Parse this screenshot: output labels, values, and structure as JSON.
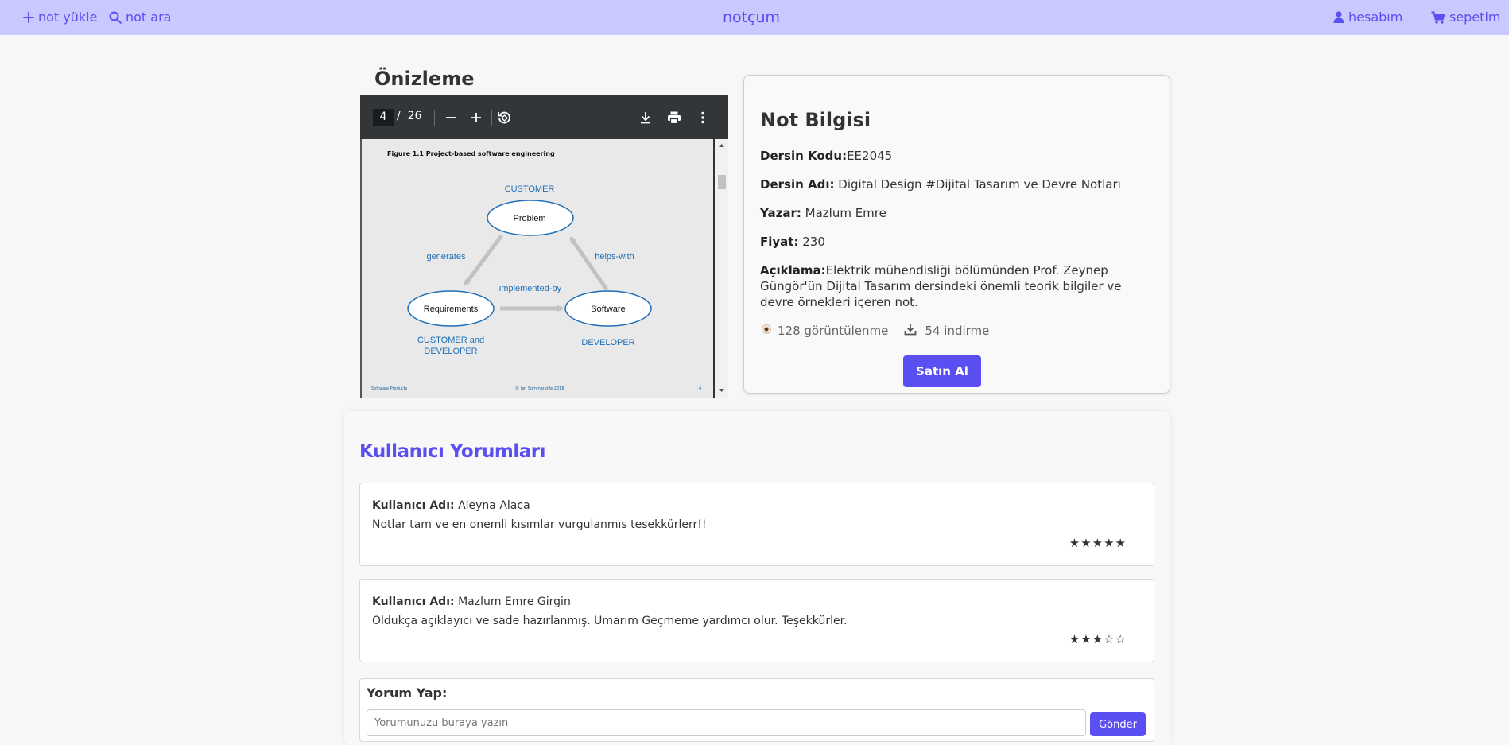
{
  "nav": {
    "upload": "not yükle",
    "search": "not ara",
    "brand": "notçum",
    "account": "hesabım",
    "cart": "sepetim"
  },
  "preview": {
    "title": "Önizleme",
    "pdf": {
      "current_page": "4",
      "page_separator": "/",
      "total_pages": "26",
      "slide_heading": "Figure 1.1 Project-based software engineering",
      "footer_left": "Software Products",
      "footer_center": "© Ian Sommerville 2018",
      "footer_right": "4",
      "diagram": {
        "node_problem": "Problem",
        "node_requirements": "Requirements",
        "node_software": "Software",
        "label_customer": "CUSTOMER",
        "label_generates": "generates",
        "label_helps_with": "helps-with",
        "label_implemented_by": "implemented-by",
        "label_customer_dev_1": "CUSTOMER and",
        "label_customer_dev_2": "DEVELOPER",
        "label_developer": "DEVELOPER"
      }
    }
  },
  "info": {
    "title": "Not Bilgisi",
    "course_code_label": "Dersin Kodu:",
    "course_code": "EE2045",
    "course_name_label": "Dersin Adı:",
    "course_name": "Digital Design #Dijital Tasarım ve Devre Notları",
    "author_label": "Yazar:",
    "author": "Mazlum Emre",
    "price_label": "Fiyat:",
    "price": "230",
    "description_label": "Açıklama:",
    "description": "Elektrik mühendisliği bölümünden Prof. Zeynep Güngör'ün Dijital Tasarım dersindeki önemli teorik bilgiler ve devre örnekleri içeren not.",
    "views": "128 görüntülenme",
    "downloads": "54 indirme",
    "buy_label": "Satın Al"
  },
  "reviews": {
    "title": "Kullanıcı Yorumları",
    "items": [
      {
        "user_label": "Kullanıcı Adı:",
        "user": "Aleyna Alaca",
        "text": "Notlar tam ve en onemli kısımlar vurgulanmıs tesekkürlerr!!",
        "stars": "★★★★★",
        "rating": 5
      },
      {
        "user_label": "Kullanıcı Adı:",
        "user": "Mazlum Emre Girgin",
        "text": "Oldukça açıklayıcı ve sade hazırlanmış. Umarım Geçmeme yardımcı olur. Teşekkürler.",
        "stars": "★★★☆☆",
        "rating": 3
      }
    ],
    "comment": {
      "label": "Yorum Yap:",
      "placeholder": "Yorumunuzu buraya yazın",
      "send": "Gönder"
    }
  },
  "colors": {
    "accent": "#5a4ff0",
    "nav_bg": "#c9c9ff",
    "diagram_blue": "#1e6fb8"
  }
}
